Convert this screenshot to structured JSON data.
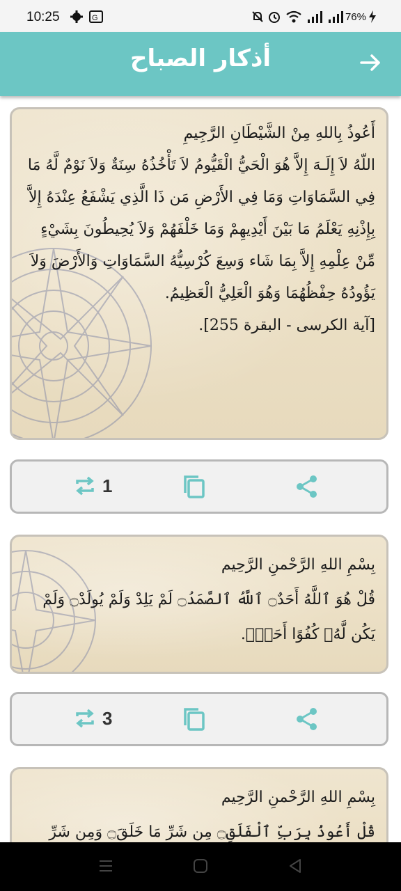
{
  "status_bar": {
    "time": "10:25",
    "battery": "76%",
    "icons": [
      "settings-icon",
      "translate-icon",
      "mute-icon",
      "alarm-icon",
      "wifi-icon",
      "signal-icon",
      "signal-icon",
      "battery-icon"
    ]
  },
  "app_bar": {
    "title": "أذكار الصباح",
    "back_icon": "arrow-right-icon",
    "color": "#6cc6c4"
  },
  "cards": [
    {
      "lines": [
        "أَعُوذُ بِاللهِ مِنْ الشَّيْطَانِ الرَّجِيمِ",
        "اللّهُ لاَ إِلَـهَ إِلاَّ هُوَ الْحَيُّ الْقَيُّومُ لاَ تَأْخُذُهُ سِنَةٌ وَلاَ نَوْمٌ لَّهُ مَا فِي السَّمَاوَاتِ وَمَا فِي الأَرْضِ مَن ذَا الَّذِي يَشْفَعُ عِنْدَهُ إِلاَّ بِإِذْنِهِ يَعْلَمُ مَا بَيْنَ أَيْدِيهِمْ وَمَا خَلْفَهُمْ وَلاَ يُحِيطُونَ بِشَيْءٍ مِّنْ عِلْمِهِ إِلاَّ بِمَا شَاء وَسِعَ كُرْسِيُّهُ السَّمَاوَاتِ وَالأَرْضَ وَلاَ يَؤُودُهُ حِفْظُهُمَا وَهُوَ الْعَلِيُّ الْعَظِيمُ.",
        "[آية الكرسى - البقرة 255]."
      ],
      "count": "1"
    },
    {
      "lines": [
        "بِسْمِ اللهِ الرَّحْمنِ الرَّحِيم",
        "قُلْ هُوَ ٱللَّهُ أَحَدٌ۝ ٱللَّهُ ٱلصَّمَدُ۝ لَمْ يَلِدْ وَلَمْ يُولَدْ۝ وَلَمْ يَكُن لَّهُۥ كُفُوًا أَحَدٌۢ."
      ],
      "count": "3"
    },
    {
      "lines": [
        "بِسْمِ اللهِ الرَّحْمنِ الرَّحِيم",
        "قُلْ أَعُوذُ بِرَبِّ ٱلْفَلَقِ۝ مِن شَرِّ مَا خَلَقَ۝ وَمِن شَرِّ"
      ]
    }
  ],
  "controls": {
    "repeat_icon": "repeat-icon",
    "copy_icon": "copy-icon",
    "share_icon": "share-icon",
    "accent": "#6cc6c4"
  },
  "nav_bar": {
    "icons": [
      "recents-icon",
      "home-icon",
      "back-icon"
    ]
  }
}
